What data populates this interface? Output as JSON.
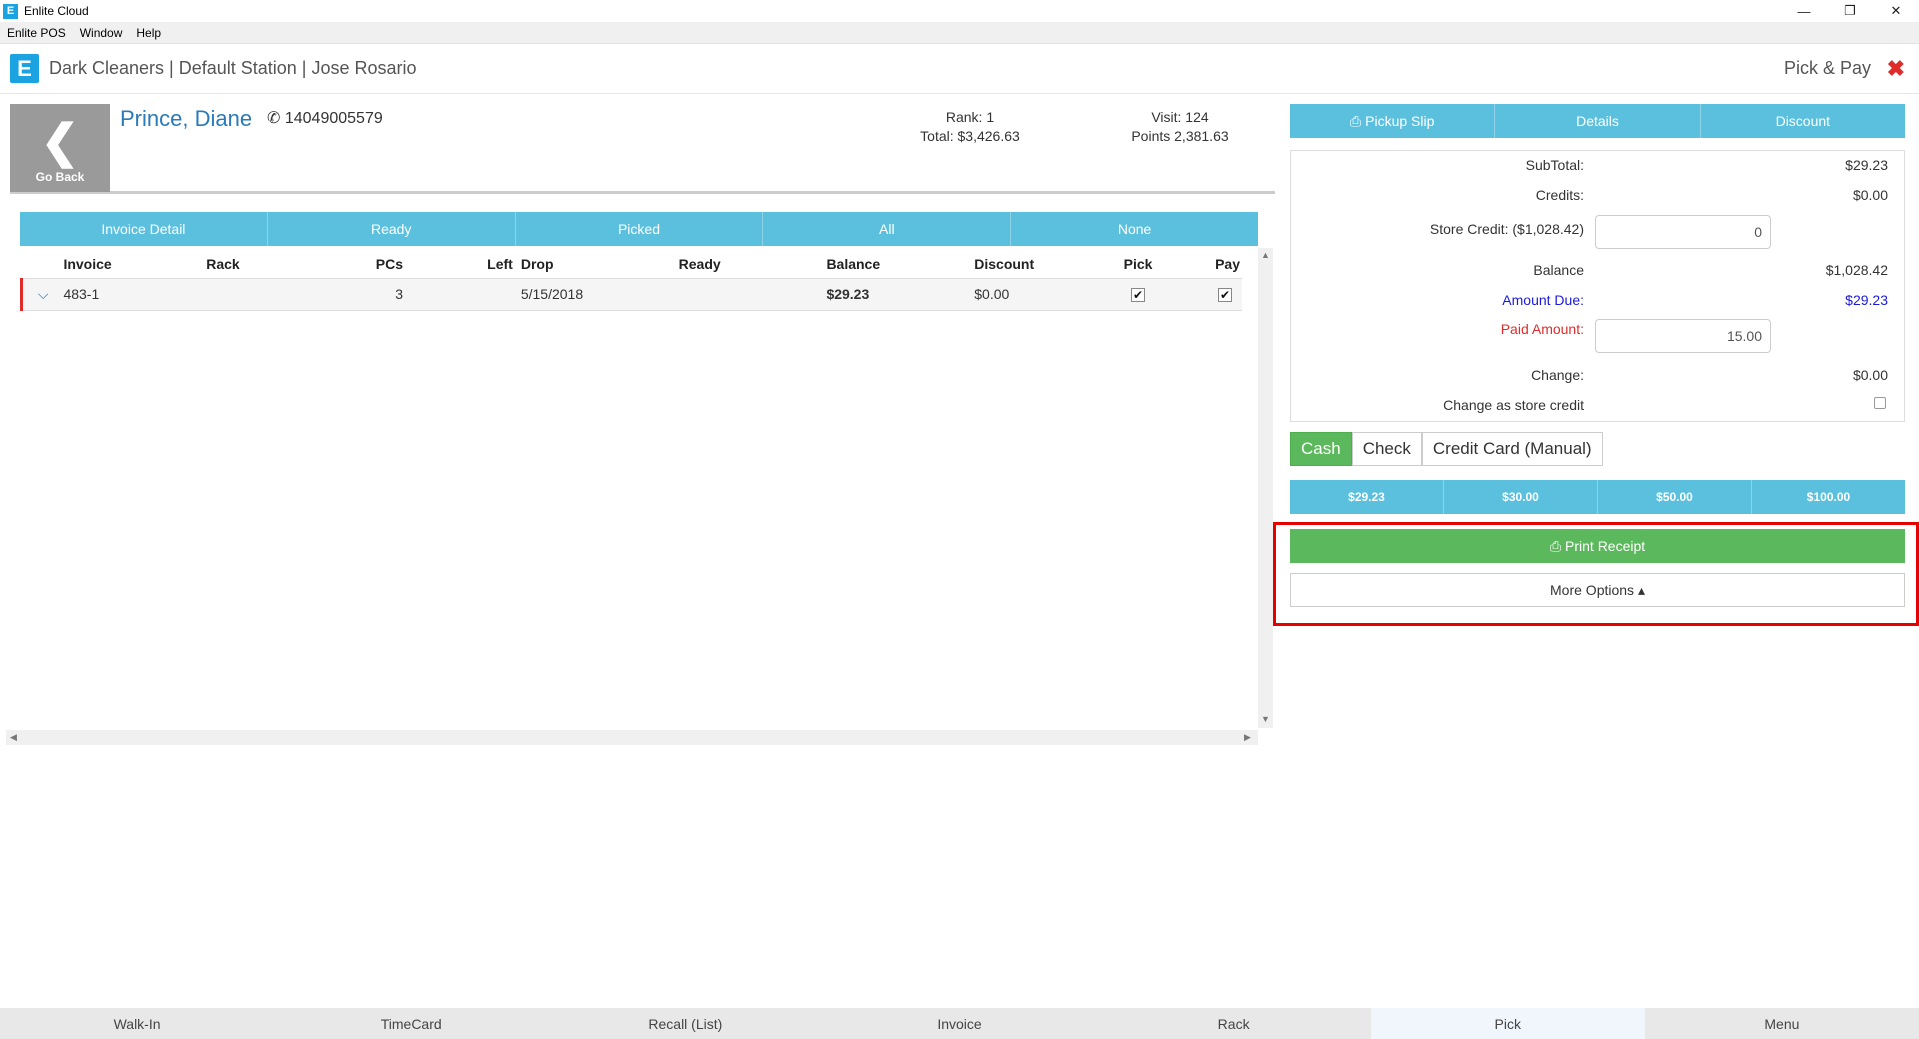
{
  "window": {
    "title": "Enlite Cloud",
    "logo": "E",
    "min": "—",
    "max": "❐",
    "close": "✕"
  },
  "menu": [
    "Enlite POS",
    "Window",
    "Help"
  ],
  "header": {
    "logo": "E",
    "station": "Dark Cleaners | Default Station | Jose Rosario",
    "page": "Pick & Pay",
    "close": "✖"
  },
  "customer": {
    "go_back": "Go Back",
    "name": "Prince, Diane",
    "phone": "14049005579",
    "rank": "Rank: 1",
    "total": "Total: $3,426.63",
    "visit": "Visit: 124",
    "points": "Points 2,381.63"
  },
  "tabs": [
    "Invoice Detail",
    "Ready",
    "Picked",
    "All",
    "None"
  ],
  "table": {
    "headers": [
      "Invoice",
      "Rack",
      "PCs",
      "Left",
      "Drop",
      "Ready",
      "Balance",
      "Discount",
      "Pick",
      "Pay"
    ],
    "rows": [
      {
        "invoice": "483-1",
        "rack": "",
        "pcs": "3",
        "left": "",
        "drop": "5/15/2018",
        "ready": "",
        "balance": "$29.23",
        "discount": "$0.00",
        "pick": "✔",
        "pay": "✔"
      }
    ]
  },
  "right_tabs": [
    "Pickup Slip",
    "Details",
    "Discount"
  ],
  "summary": {
    "subtotal_label": "SubTotal:",
    "subtotal": "$29.23",
    "credits_label": "Credits:",
    "credits": "$0.00",
    "store_credit_label": "Store Credit: ($1,028.42)",
    "store_credit_value": "0",
    "balance_label": "Balance",
    "balance": "$1,028.42",
    "amount_due_label": "Amount Due:",
    "amount_due": "$29.23",
    "paid_label": "Paid Amount:",
    "paid_value": "15.00",
    "change_label": "Change:",
    "change": "$0.00",
    "change_credit_label": "Change as store credit"
  },
  "payment_methods": [
    "Cash",
    "Check",
    "Credit Card (Manual)"
  ],
  "quick_amounts": [
    "$29.23",
    "$30.00",
    "$50.00",
    "$100.00"
  ],
  "actions": {
    "print": "Print Receipt",
    "more": "More Options ▴"
  },
  "bottom_nav": [
    "Walk-In",
    "TimeCard",
    "Recall (List)",
    "Invoice",
    "Rack",
    "Pick",
    "Menu"
  ],
  "colors": {
    "accent": "#5bc0de",
    "success": "#5cb85c",
    "highlight": "#e60000",
    "due": "#1a1adb",
    "paid": "#e02b2b"
  }
}
